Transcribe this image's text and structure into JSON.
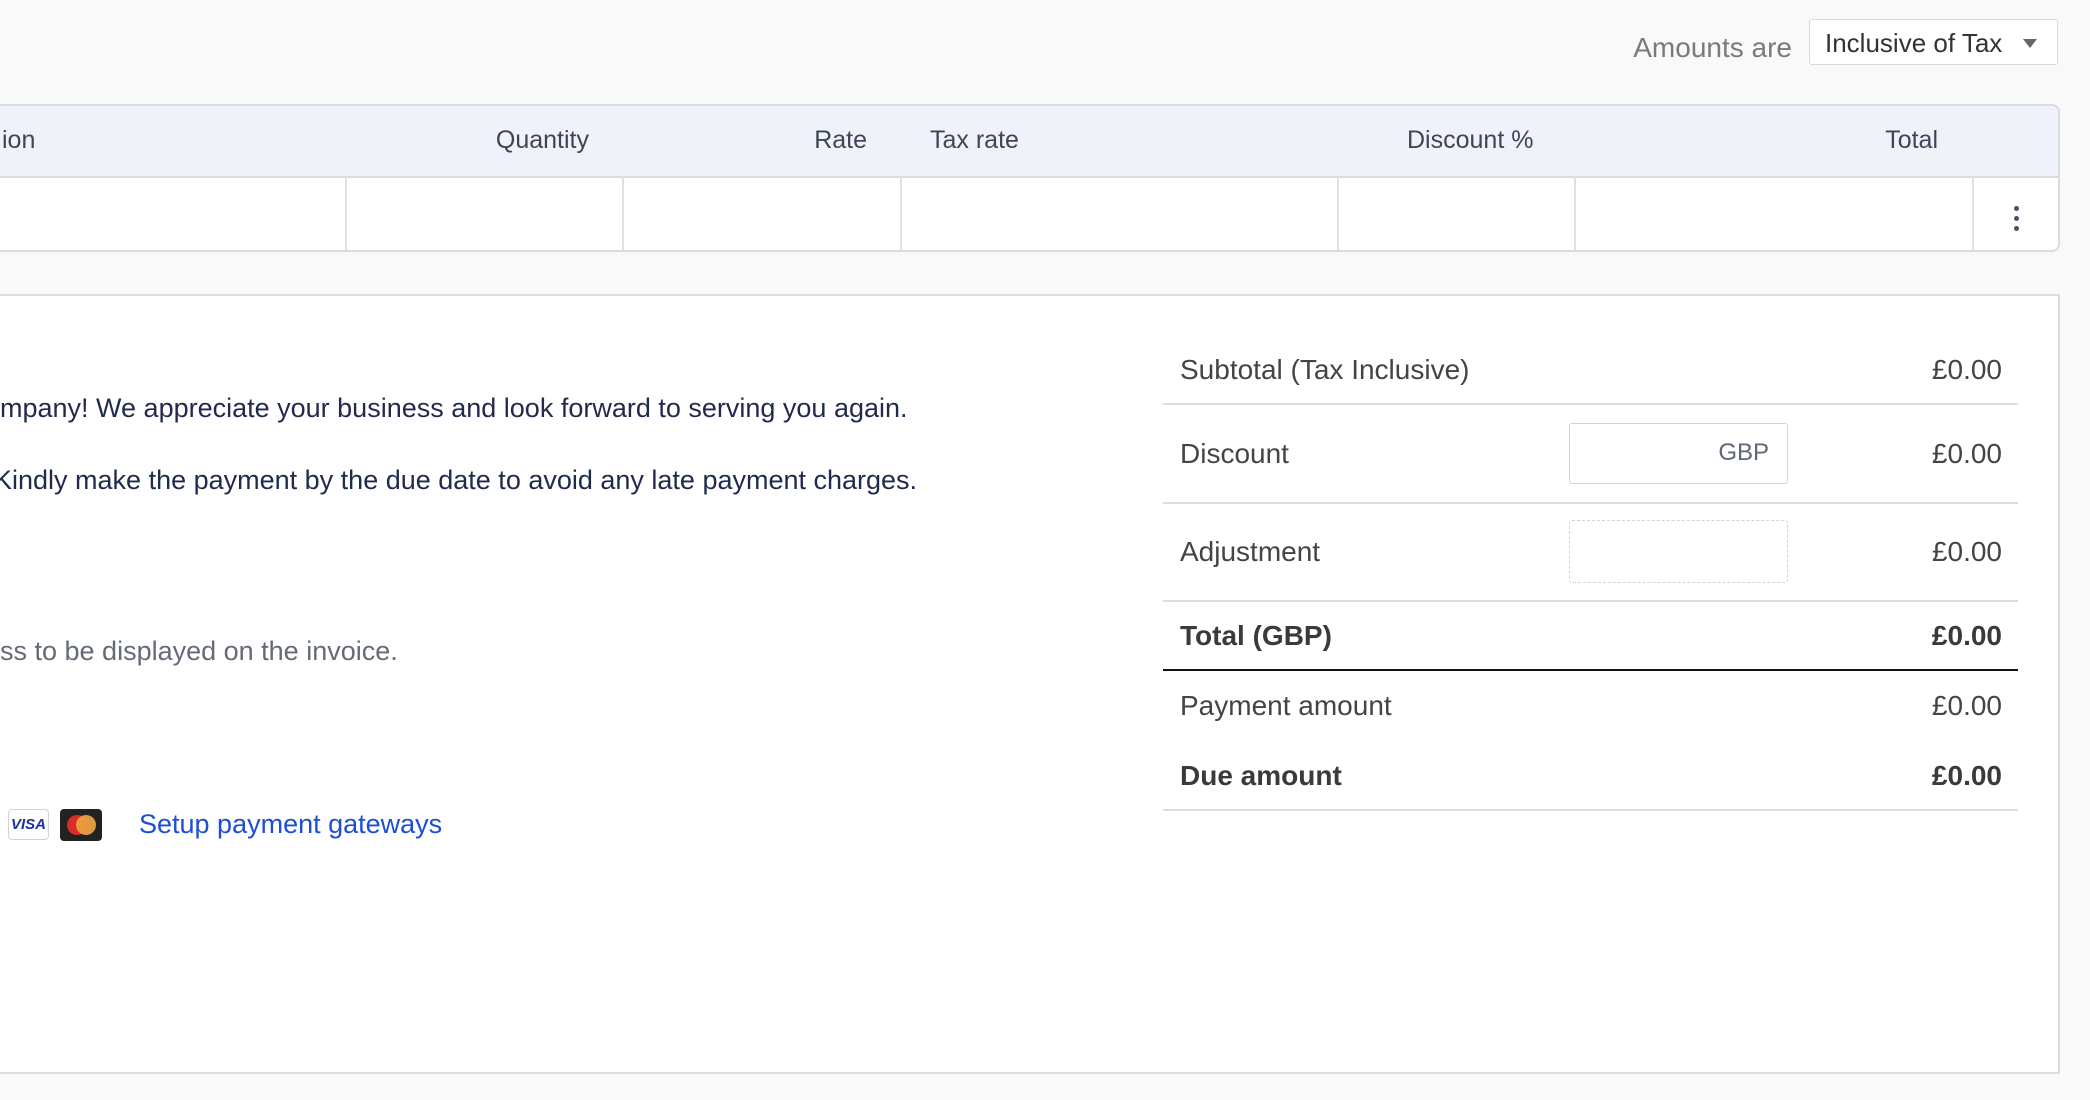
{
  "toolbar": {
    "amounts_label": "Amounts are",
    "tax_mode": "Inclusive of Tax"
  },
  "table": {
    "headers": {
      "description": "ion",
      "quantity": "Quantity",
      "rate": "Rate",
      "tax_rate": "Tax rate",
      "discount": "Discount %",
      "total": "Total"
    }
  },
  "notes": {
    "line1": "mpany! We appreciate your business and look forward to serving you again.",
    "line2": "Kindly make the payment by the due date to avoid any late payment charges.",
    "hint": "ss to be displayed on the invoice."
  },
  "payment": {
    "visa": "VISA",
    "setup_link": "Setup payment gateways"
  },
  "summary": {
    "subtotal_label": "Subtotal (Tax Inclusive)",
    "subtotal_value": "£0.00",
    "discount_label": "Discount",
    "discount_currency": "GBP",
    "discount_value": "£0.00",
    "adjustment_label": "Adjustment",
    "adjustment_value": "£0.00",
    "total_label": "Total (GBP)",
    "total_value": "£0.00",
    "payment_label": "Payment amount",
    "payment_value": "£0.00",
    "due_label": "Due amount",
    "due_value": "£0.00"
  },
  "colors": {
    "link": "#1d4ed8",
    "header_bg": "#f0f2fa",
    "note_text": "#1f2a4d"
  }
}
